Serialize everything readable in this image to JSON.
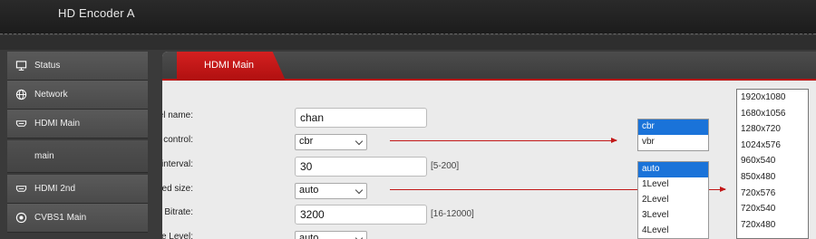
{
  "header": {
    "title": "HD Encoder  A"
  },
  "sidebar": {
    "items": [
      {
        "label": "Status",
        "icon": "monitor-icon"
      },
      {
        "label": "Network",
        "icon": "globe-icon"
      },
      {
        "label": "HDMI Main",
        "icon": "hdmi-icon"
      },
      {
        "label": "main",
        "icon": ""
      },
      {
        "label": "HDMI 2nd",
        "icon": "hdmi-icon"
      },
      {
        "label": "CVBS1 Main",
        "icon": "target-icon"
      }
    ]
  },
  "panel": {
    "tab_label": "HDMI Main"
  },
  "form": {
    "channel_name": {
      "label": "channel name:",
      "value": "chan"
    },
    "bitrate_control": {
      "label": "Bitrate control:",
      "value": "cbr"
    },
    "key_interval": {
      "label": "Key interval:",
      "value": "30",
      "hint": "[5-200]"
    },
    "encoded_size": {
      "label": "Encoded size:",
      "value": "auto"
    },
    "bitrate": {
      "label": "Bitrate:",
      "value": "3200",
      "hint": "[16-12000]"
    },
    "fluctuate_level": {
      "label": "Fluctuate Level:",
      "value": "auto"
    }
  },
  "popups": {
    "bitrate_options": [
      "cbr",
      "vbr"
    ],
    "level_options": [
      "auto",
      "1Level",
      "2Level",
      "3Level",
      "4Level"
    ],
    "resolution_options": [
      "1920x1080",
      "1680x1056",
      "1280x720",
      "1024x576",
      "960x540",
      "850x480",
      "720x576",
      "720x540",
      "720x480"
    ]
  },
  "colors": {
    "accent": "#c21818",
    "selection": "#1a73d9"
  }
}
